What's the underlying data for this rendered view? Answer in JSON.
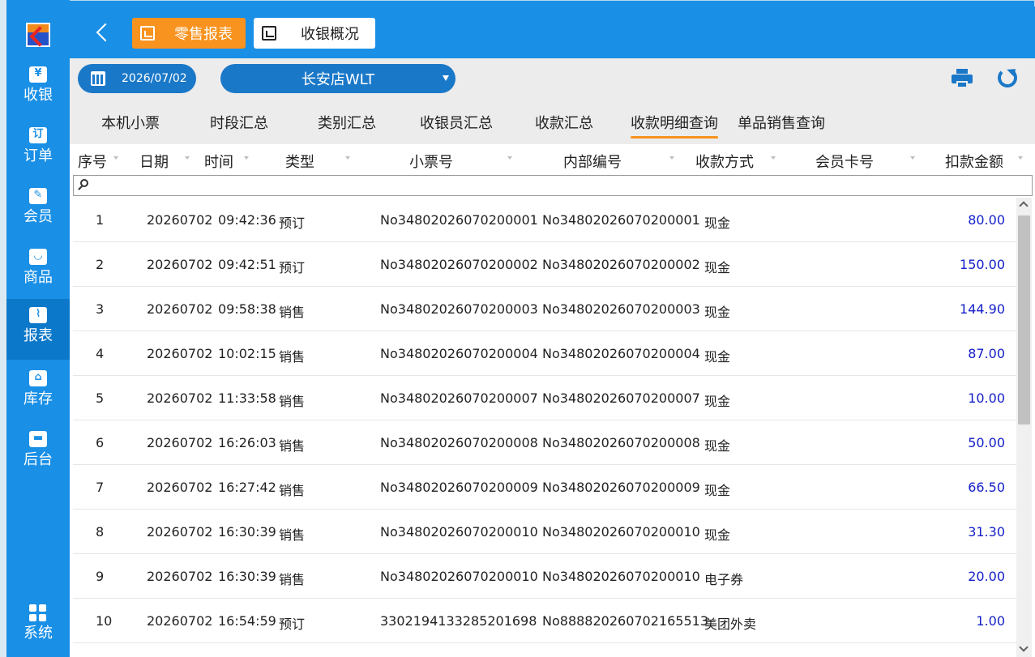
{
  "colors": {
    "primary": "#1a8fe6",
    "pill": "#1a78c8",
    "accent": "#f7931e",
    "amount": "#1520c8"
  },
  "sidebar": {
    "items": [
      {
        "label": "收银",
        "icon": "cash-register-icon",
        "glyph": "¥"
      },
      {
        "label": "订单",
        "icon": "order-icon",
        "glyph": "订"
      },
      {
        "label": "会员",
        "icon": "member-icon",
        "glyph": "✎"
      },
      {
        "label": "商品",
        "icon": "goods-bag-icon",
        "glyph": "◡"
      },
      {
        "label": "报表",
        "icon": "report-chart-icon",
        "glyph": "⌇"
      },
      {
        "label": "库存",
        "icon": "warehouse-icon",
        "glyph": "⌂"
      },
      {
        "label": "后台",
        "icon": "store-icon",
        "glyph": "▬"
      },
      {
        "label": "系统",
        "icon": "grid-icon",
        "glyph": ""
      }
    ]
  },
  "topbar": {
    "tab_retail_report": "零售报表",
    "tab_cashier_overview": "收银概况"
  },
  "toolbar": {
    "date": "2026/07/02",
    "store": "长安店WLT"
  },
  "subtabs": [
    "本机小票",
    "时段汇总",
    "类别汇总",
    "收银员汇总",
    "收款汇总",
    "收款明细查询",
    "单品销售查询"
  ],
  "table": {
    "columns": [
      "序号",
      "日期",
      "时间",
      "类型",
      "小票号",
      "内部编号",
      "收款方式",
      "会员卡号",
      "扣款金额"
    ],
    "filter_placeholder": "",
    "rows": [
      {
        "no": "1",
        "date": "20260702",
        "time": "09:42:36",
        "type": "预订",
        "ticket": "No34802026070200001",
        "internal": "No34802026070200001",
        "method": "现金",
        "card": "",
        "amount": "80.00"
      },
      {
        "no": "2",
        "date": "20260702",
        "time": "09:42:51",
        "type": "预订",
        "ticket": "No34802026070200002",
        "internal": "No34802026070200002",
        "method": "现金",
        "card": "",
        "amount": "150.00"
      },
      {
        "no": "3",
        "date": "20260702",
        "time": "09:58:38",
        "type": "销售",
        "ticket": "No34802026070200003",
        "internal": "No34802026070200003",
        "method": "现金",
        "card": "",
        "amount": "144.90"
      },
      {
        "no": "4",
        "date": "20260702",
        "time": "10:02:15",
        "type": "销售",
        "ticket": "No34802026070200004",
        "internal": "No34802026070200004",
        "method": "现金",
        "card": "",
        "amount": "87.00"
      },
      {
        "no": "5",
        "date": "20260702",
        "time": "11:33:58",
        "type": "销售",
        "ticket": "No34802026070200007",
        "internal": "No34802026070200007",
        "method": "现金",
        "card": "",
        "amount": "10.00"
      },
      {
        "no": "6",
        "date": "20260702",
        "time": "16:26:03",
        "type": "销售",
        "ticket": "No34802026070200008",
        "internal": "No34802026070200008",
        "method": "现金",
        "card": "",
        "amount": "50.00"
      },
      {
        "no": "7",
        "date": "20260702",
        "time": "16:27:42",
        "type": "销售",
        "ticket": "No34802026070200009",
        "internal": "No34802026070200009",
        "method": "现金",
        "card": "",
        "amount": "66.50"
      },
      {
        "no": "8",
        "date": "20260702",
        "time": "16:30:39",
        "type": "销售",
        "ticket": "No34802026070200010",
        "internal": "No34802026070200010",
        "method": "现金",
        "card": "",
        "amount": "31.30"
      },
      {
        "no": "9",
        "date": "20260702",
        "time": "16:30:39",
        "type": "销售",
        "ticket": "No34802026070200010",
        "internal": "No34802026070200010",
        "method": "电子券",
        "card": "",
        "amount": "20.00"
      },
      {
        "no": "10",
        "date": "20260702",
        "time": "16:54:59",
        "type": "预订",
        "ticket": "3302194133285201698",
        "internal": "No888820260702165513",
        "method": "美团外卖",
        "card": "",
        "amount": "1.00"
      }
    ]
  }
}
